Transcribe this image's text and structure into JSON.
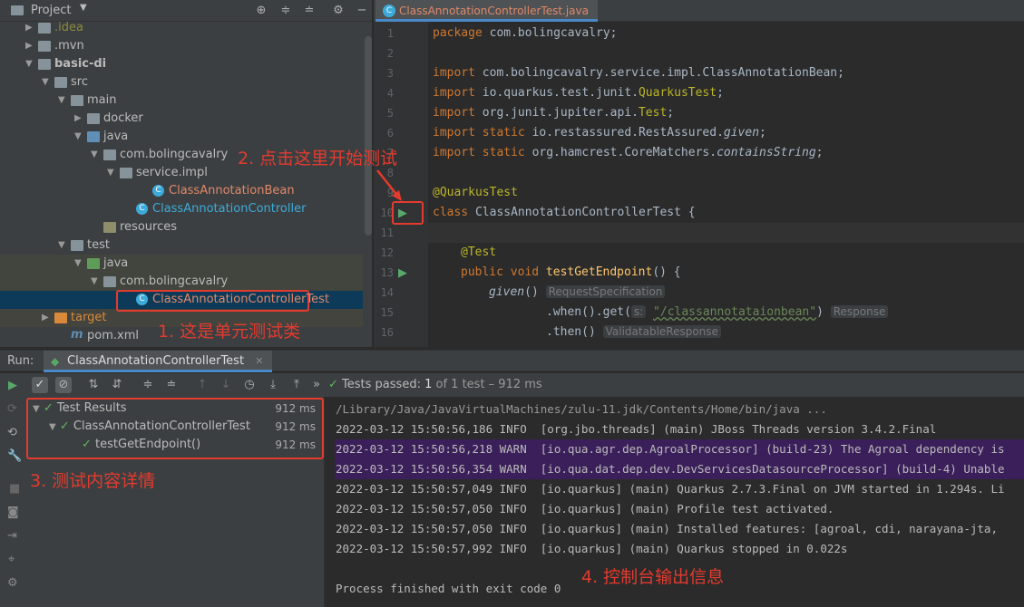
{
  "project_panel": {
    "title": "Project",
    "tree": [
      {
        "label": ".idea",
        "color": "#8a8b3c"
      },
      {
        "label": ".mvn"
      },
      {
        "label": "basic-di"
      },
      {
        "label": "src"
      },
      {
        "label": "main"
      },
      {
        "label": "docker"
      },
      {
        "label": "java"
      },
      {
        "label": "com.bolingcavalry"
      },
      {
        "label": "service.impl"
      },
      {
        "label": "ClassAnnotationBean",
        "color": "#e0896a"
      },
      {
        "label": "ClassAnnotationController",
        "color": "#3cabd9"
      },
      {
        "label": "resources"
      },
      {
        "label": "test"
      },
      {
        "label": "java"
      },
      {
        "label": "com.bolingcavalry"
      },
      {
        "label": "ClassAnnotationControllerTest",
        "color": "#e0896a"
      },
      {
        "label": "target",
        "color": "#d88a3a"
      },
      {
        "label": "pom.xml"
      }
    ]
  },
  "editor": {
    "tab_label": "ClassAnnotationControllerTest.java",
    "line_numbers": [
      "1",
      "2",
      "3",
      "4",
      "5",
      "6",
      "7",
      "8",
      "9",
      "10",
      "11",
      "12",
      "13",
      "14",
      "15",
      "16"
    ],
    "lines": {
      "l1_kw": "package",
      "l1_rest": " com.bolingcavalry;",
      "l3_kw": "import",
      "l3_rest": " com.bolingcavalry.service.impl.ClassAnnotationBean;",
      "l4_kw": "import",
      "l4_a": " io.quarkus.test.junit.",
      "l4_b": "QuarkusTest",
      "l4_c": ";",
      "l5_kw": "import",
      "l5_a": " org.junit.jupiter.api.",
      "l5_b": "Test",
      "l5_c": ";",
      "l6_kw": "import static",
      "l6_a": " io.restassured.RestAssured.",
      "l6_b": "given",
      "l6_c": ";",
      "l7_kw": "import static",
      "l7_a": " org.hamcrest.CoreMatchers.",
      "l7_b": "containsString",
      "l7_c": ";",
      "l9": "@QuarkusTest",
      "l10_kw": "class",
      "l10_rest": " ClassAnnotationControllerTest {",
      "l12": "@Test",
      "l13_kw": "public void",
      "l13_fn": " testGetEndpoint",
      "l13_rest": "() {",
      "l14_fn": "given",
      "l14_rest": "()",
      "l14_hint": "RequestSpecification",
      "l15_a": ".when().get(",
      "l15_hint1": "s:",
      "l15_str": "\"/classannotataionbean\"",
      "l15_b": ")",
      "l15_hint2": "Response",
      "l16_a": ".then()",
      "l16_hint": "ValidatableResponse"
    }
  },
  "run_panel": {
    "label": "Run:",
    "tab_label": "ClassAnnotationControllerTest",
    "status_prefix": "Tests passed:",
    "status_count": "1",
    "status_suffix": "of 1 test – 912 ms",
    "results": [
      {
        "label": "Test Results",
        "time": "912 ms"
      },
      {
        "label": "ClassAnnotationControllerTest",
        "time": "912 ms"
      },
      {
        "label": "testGetEndpoint()",
        "time": "912 ms"
      }
    ],
    "console": [
      "/Library/Java/JavaVirtualMachines/zulu-11.jdk/Contents/Home/bin/java ...",
      "2022-03-12 15:50:56,186 INFO  [org.jbo.threads] (main) JBoss Threads version 3.4.2.Final",
      "2022-03-12 15:50:56,218 WARN  [io.qua.agr.dep.AgroalProcessor] (build-23) The Agroal dependency is",
      "2022-03-12 15:50:56,354 WARN  [io.qua.dat.dep.dev.DevServicesDatasourceProcessor] (build-4) Unable",
      "2022-03-12 15:50:57,049 INFO  [io.quarkus] (main) Quarkus 2.7.3.Final on JVM started in 1.294s. Li",
      "2022-03-12 15:50:57,050 INFO  [io.quarkus] (main) Profile test activated.",
      "2022-03-12 15:50:57,050 INFO  [io.quarkus] (main) Installed features: [agroal, cdi, narayana-jta,",
      "2022-03-12 15:50:57,992 INFO  [io.quarkus] (main) Quarkus stopped in 0.022s",
      "",
      "Process finished with exit code 0"
    ]
  },
  "annotations": {
    "a1": "1. 这是单元测试类",
    "a2": "2. 点击这里开始测试",
    "a3": "3. 测试内容详情",
    "a4": "4. 控制台输出信息"
  }
}
